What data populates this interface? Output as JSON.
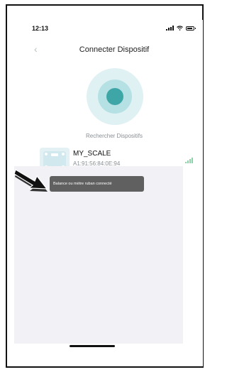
{
  "status_bar": {
    "time": "12:13",
    "icons": [
      "cellular-signal-icon",
      "wifi-icon",
      "battery-icon"
    ]
  },
  "nav": {
    "back_icon": "chevron-left-icon",
    "title": "Connecter Dispositif"
  },
  "search": {
    "icon": "radar-scan-icon",
    "label": "Rechercher Dispositifs"
  },
  "devices": [
    {
      "name": "MY_SCALE",
      "address": "A1:91:56:84:0E:94",
      "icon": "scale-icon",
      "signal_icon": "signal-strength-icon"
    }
  ],
  "toast": {
    "message": "Balance ou mètre ruban connecté"
  },
  "annotation": {
    "icon": "pointer-arrow-icon"
  },
  "colors": {
    "accent": "#3fa6a8",
    "radar_outer": "#dff1f3",
    "radar_mid": "#b6e1e4",
    "signal_green": "#8fd1a8",
    "list_background": "#f1f1f6",
    "toast_background": "#606060"
  }
}
